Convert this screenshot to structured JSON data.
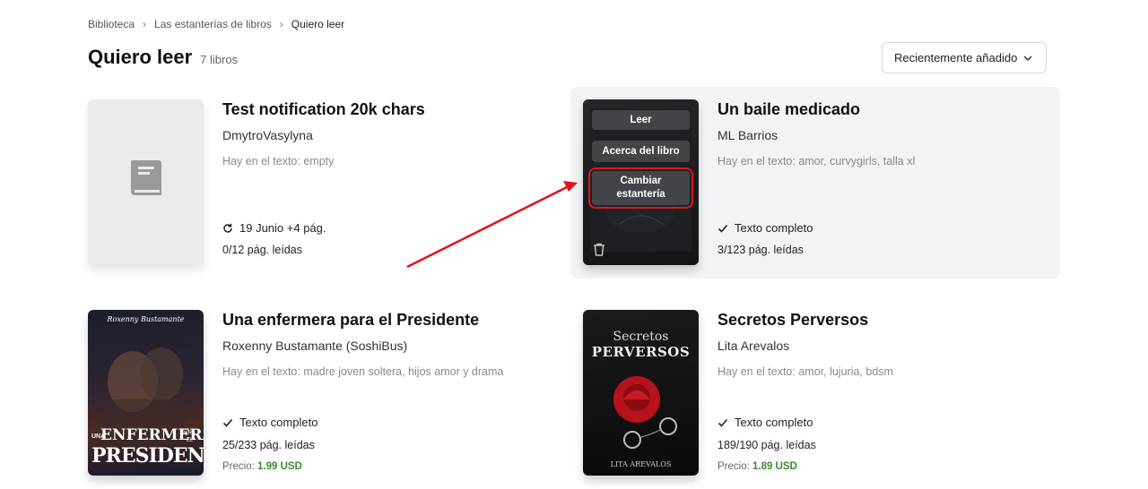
{
  "breadcrumb": {
    "items": [
      "Biblioteca",
      "Las estanterías de libros",
      "Quiero leer"
    ]
  },
  "header": {
    "title": "Quiero leer",
    "count": "7 libros"
  },
  "sort": {
    "selected": "Recientemente añadido"
  },
  "tags_prefix": "Hay en el texto:",
  "price_prefix": "Precio:",
  "books": [
    {
      "title": "Test notification 20k chars",
      "author": "DmytroVasylyna",
      "tags": "empty",
      "status": "19 Junio +4 pág.",
      "status_icon": "refresh-icon",
      "pages_read": "0/12 pág. leídas"
    },
    {
      "title": "Un baile medicado",
      "author": "ML Barrios",
      "tags": "amor, curvygirls, talla xl",
      "status": "Texto completo",
      "status_icon": "check-icon",
      "pages_read": "3/123 pág. leídas",
      "cover_menu": {
        "read": "Leer",
        "about": "Acerca del libro",
        "change_shelf_1": "Cambiar",
        "change_shelf_2": "estantería"
      }
    },
    {
      "title": "Una enfermera para el Presidente",
      "author": "Roxenny Bustamante (SoshiBus)",
      "tags": "madre joven soltera, hijos amor y drama",
      "status": "Texto completo",
      "status_icon": "check-icon",
      "pages_read": "25/233 pág. leídas",
      "price": "1.99 USD",
      "cover": {
        "author_script": "Roxenny Bustamante",
        "word_1": "UNA",
        "word_2": "ENFERMERA",
        "word_3": "PARA",
        "word_4": "EL",
        "word_5": "PRESIDENTE"
      }
    },
    {
      "title": "Secretos Perversos",
      "author": "Lita Arevalos",
      "tags": "amor, lujuria, bdsm",
      "status": "Texto completo",
      "status_icon": "check-icon",
      "pages_read": "189/190 pág. leídas",
      "price": "1.89 USD",
      "cover": {
        "line_1": "Secretos",
        "line_2": "PERVERSOS",
        "author": "LITA AREVALOS"
      }
    }
  ],
  "colors": {
    "highlight_box": "#e0141c",
    "price": "#3c8a2e",
    "card_hover_bg": "#f2f3f5"
  }
}
